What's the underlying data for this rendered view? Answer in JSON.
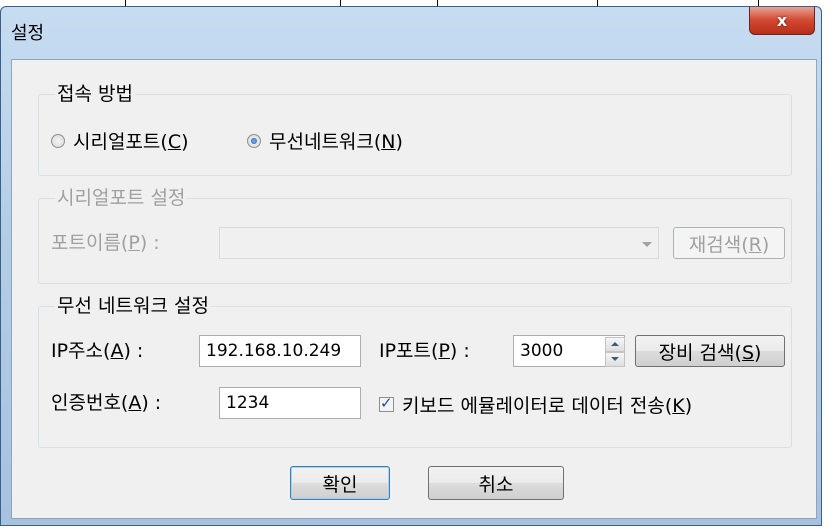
{
  "window": {
    "title": "설정",
    "close_glyph": "x"
  },
  "connection": {
    "group_title": "접속 방법",
    "radio_serial_prefix": "시리얼포트(",
    "radio_serial_key": "C",
    "radio_serial_suffix": ")",
    "radio_wireless_prefix": "무선네트워크(",
    "radio_wireless_key": "N",
    "radio_wireless_suffix": ")",
    "selected": "wireless"
  },
  "serial": {
    "group_title": "시리얼포트 설정",
    "port_label_prefix": "포트이름(",
    "port_label_key": "P",
    "port_label_suffix": ") :",
    "port_value": "",
    "rescan_prefix": "재검색(",
    "rescan_key": "R",
    "rescan_suffix": ")"
  },
  "wireless": {
    "group_title": "무선 네트워크 설정",
    "ip_label_prefix": "IP주소(",
    "ip_label_key": "A",
    "ip_label_suffix": ") :",
    "ip_value": "192.168.10.249",
    "port_label_prefix": "IP포트(",
    "port_label_key": "P",
    "port_label_suffix": ") :",
    "port_value": "3000",
    "search_prefix": "장비 검색(",
    "search_key": "S",
    "search_suffix": ")",
    "auth_label_prefix": "인증번호(",
    "auth_label_key": "A",
    "auth_label_suffix": ") :",
    "auth_value": "1234",
    "keyboard_prefix": "키보드 에뮬레이터로 데이터 전송(",
    "keyboard_key": "K",
    "keyboard_suffix": ")",
    "keyboard_checked": true
  },
  "footer": {
    "ok_label": "확인",
    "cancel_label": "취소"
  },
  "colors": {
    "frame": "#b3cde6",
    "client": "#f0f0f0",
    "close": "#d2472f",
    "disabled_text": "#a0a0a0"
  }
}
